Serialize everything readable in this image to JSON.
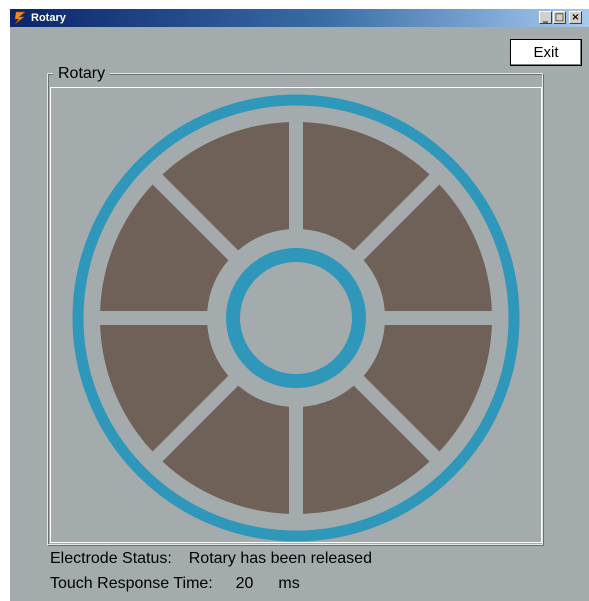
{
  "window": {
    "title": "Rotary",
    "controls": {
      "minimize": "_",
      "maximize": "□",
      "close": "×"
    }
  },
  "toolbar": {
    "exit_label": "Exit"
  },
  "group": {
    "label": "Rotary"
  },
  "rotary": {
    "segment_count": 8,
    "ring_color": "#2f97ba",
    "segment_color": "#6f6058",
    "background_color": "#a3abad"
  },
  "status": {
    "electrode_label": "Electrode Status:",
    "electrode_value": "Rotary has been released",
    "touch_label": "Touch Response Time:",
    "touch_value": "20",
    "touch_unit": "ms"
  }
}
